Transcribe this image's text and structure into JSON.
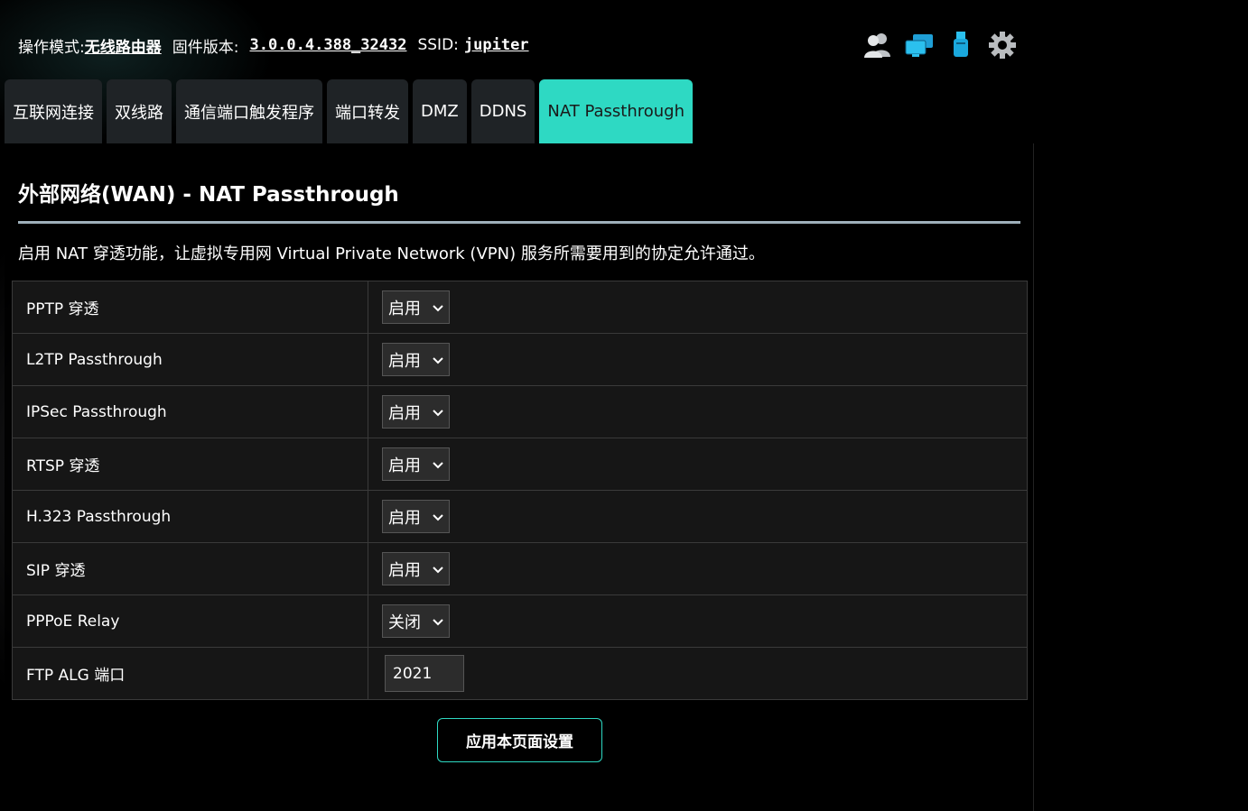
{
  "topbar": {
    "mode_label": "操作模式:",
    "mode_value": "无线路由器",
    "firmware_label": "固件版本:",
    "firmware_value": "3.0.0.4.388_32432",
    "ssid_label": "SSID:",
    "ssid_value": "jupiter"
  },
  "icons": [
    "users-icon",
    "network-computers-icon",
    "usb-icon",
    "gear-icon"
  ],
  "tabs": [
    {
      "label": "互联网连接",
      "active": false
    },
    {
      "label": "双线路",
      "active": false
    },
    {
      "label": "通信端口触发程序",
      "active": false
    },
    {
      "label": "端口转发",
      "active": false
    },
    {
      "label": "DMZ",
      "active": false
    },
    {
      "label": "DDNS",
      "active": false
    },
    {
      "label": "NAT Passthrough",
      "active": true
    }
  ],
  "panel": {
    "title": "外部网络(WAN) - NAT Passthrough",
    "description": "启用 NAT 穿透功能，让虚拟专用网 Virtual Private Network (VPN) 服务所需要用到的协定允许通过。"
  },
  "settings": [
    {
      "label": "PPTP 穿透",
      "value": "启用"
    },
    {
      "label": "L2TP Passthrough",
      "value": "启用"
    },
    {
      "label": "IPSec Passthrough",
      "value": "启用"
    },
    {
      "label": "RTSP 穿透",
      "value": "启用"
    },
    {
      "label": "H.323 Passthrough",
      "value": "启用"
    },
    {
      "label": "SIP 穿透",
      "value": "启用"
    },
    {
      "label": "PPPoE Relay",
      "value": "关闭"
    },
    {
      "label": "FTP ALG 端口",
      "value": "2021"
    }
  ],
  "apply_button": "应用本页面设置",
  "colors": {
    "accent": "#2ed9c3",
    "tab_bg": "#1f2326",
    "panel_bg": "#000000"
  }
}
